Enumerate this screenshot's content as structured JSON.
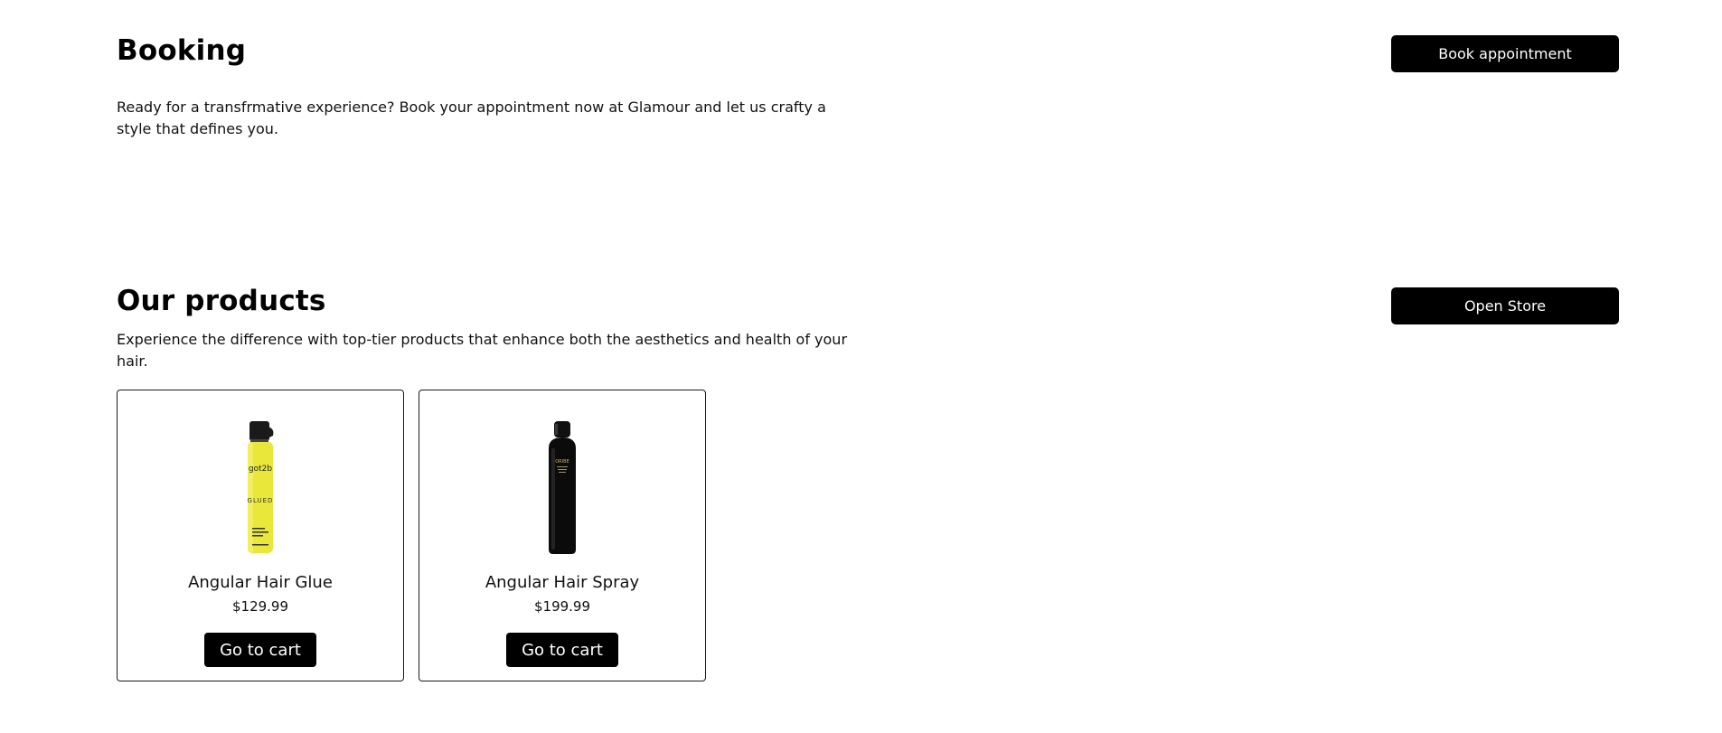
{
  "booking": {
    "title": "Booking",
    "description": "Ready for a transfrmative experience? Book your appointment now at Glamour and let us crafty a style that defines you.",
    "button_label": "Book appointment"
  },
  "products": {
    "title": "Our products",
    "description": "Experience the difference with top-tier products that enhance both the aesthetics and health of your hair.",
    "button_label": "Open Store",
    "items": [
      {
        "name": "Angular Hair Glue",
        "price": "$129.99",
        "button_label": "Go to cart",
        "image_brand": "got2b",
        "image_label": "GLUED",
        "image_color": "#e9e83a"
      },
      {
        "name": "Angular Hair Spray",
        "price": "$199.99",
        "button_label": "Go to cart",
        "image_brand": "ORIBE",
        "image_color": "#0b0b0b"
      }
    ]
  },
  "colors": {
    "primary_button": "#000000",
    "button_text": "#ffffff",
    "card_border": "#1a1a1a"
  }
}
